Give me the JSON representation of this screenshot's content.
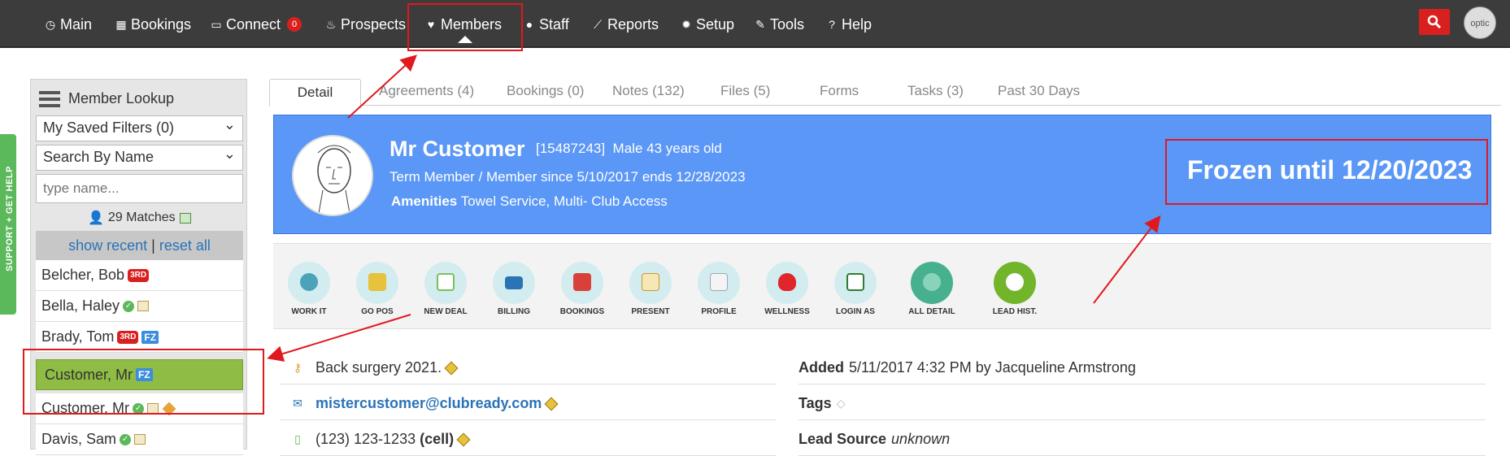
{
  "nav": {
    "items": [
      {
        "label": "Main",
        "icon": "dashboard-icon"
      },
      {
        "label": "Bookings",
        "icon": "calendar-icon"
      },
      {
        "label": "Connect",
        "icon": "chat-icon",
        "badge": "0"
      },
      {
        "label": "Prospects",
        "icon": "fire-icon"
      },
      {
        "label": "Members",
        "icon": "heart-icon"
      },
      {
        "label": "Staff",
        "icon": "user-icon"
      },
      {
        "label": "Reports",
        "icon": "chart-icon"
      },
      {
        "label": "Setup",
        "icon": "gear-icon"
      },
      {
        "label": "Tools",
        "icon": "wrench-icon"
      },
      {
        "label": "Help",
        "icon": "help-icon"
      }
    ],
    "avatar_alt": "optic"
  },
  "support_tab": "SUPPORT + GET HELP",
  "lookup": {
    "title": "Member Lookup",
    "saved_filters": "My Saved Filters (0)",
    "search_by": "Search By Name",
    "name_placeholder": "type name...",
    "matches": "29 Matches",
    "show_recent": "show recent",
    "separator": "|",
    "reset_all": "reset all",
    "members": [
      {
        "name": "Belcher, Bob",
        "tags": [
          "3RD"
        ]
      },
      {
        "name": "Bella, Haley",
        "tags": []
      },
      {
        "name": "Brady, Tom",
        "tags": [
          "3RD",
          "FZ"
        ]
      },
      {
        "name": "Customer, Mr",
        "tags": [
          "FZ"
        ],
        "active": true
      },
      {
        "name": "Customer, Mr",
        "tags": []
      },
      {
        "name": "Davis, Sam",
        "tags": []
      }
    ]
  },
  "tabs": [
    "Detail",
    "Agreements (4)",
    "Bookings (0)",
    "Notes (132)",
    "Files (5)",
    "Forms",
    "Tasks (3)",
    "Past 30 Days"
  ],
  "member": {
    "name": "Mr Customer",
    "id": "[15487243]",
    "demo": "Male 43 years old",
    "membership": "Term Member / Member since 5/10/2017 ends 12/28/2023",
    "amenities_label": "Amenities",
    "amenities": "Towel Service, Multi- Club Access",
    "frozen": "Frozen until 12/20/2023"
  },
  "actions": [
    "WORK IT",
    "GO POS",
    "NEW DEAL",
    "BILLING",
    "BOOKINGS",
    "PRESENT",
    "PROFILE",
    "WELLNESS",
    "LOGIN AS",
    "ALL DETAIL",
    "LEAD HIST."
  ],
  "details_left": {
    "note": "Back surgery 2021.",
    "email": "mistercustomer@clubready.com",
    "phone": "(123) 123-1233",
    "phone_type": "(cell)"
  },
  "details_right": {
    "added_label": "Added",
    "added_value": "5/11/2017 4:32 PM by Jacqueline Armstrong",
    "tags_label": "Tags",
    "lead_source_label": "Lead Source",
    "lead_source_value": "unknown"
  },
  "colors": {
    "nav_bg": "#3c3c3c",
    "banner_bg": "#5b97f6",
    "active_row": "#8fbc45",
    "alert_red": "#e0191f",
    "link": "#2a73b6"
  }
}
